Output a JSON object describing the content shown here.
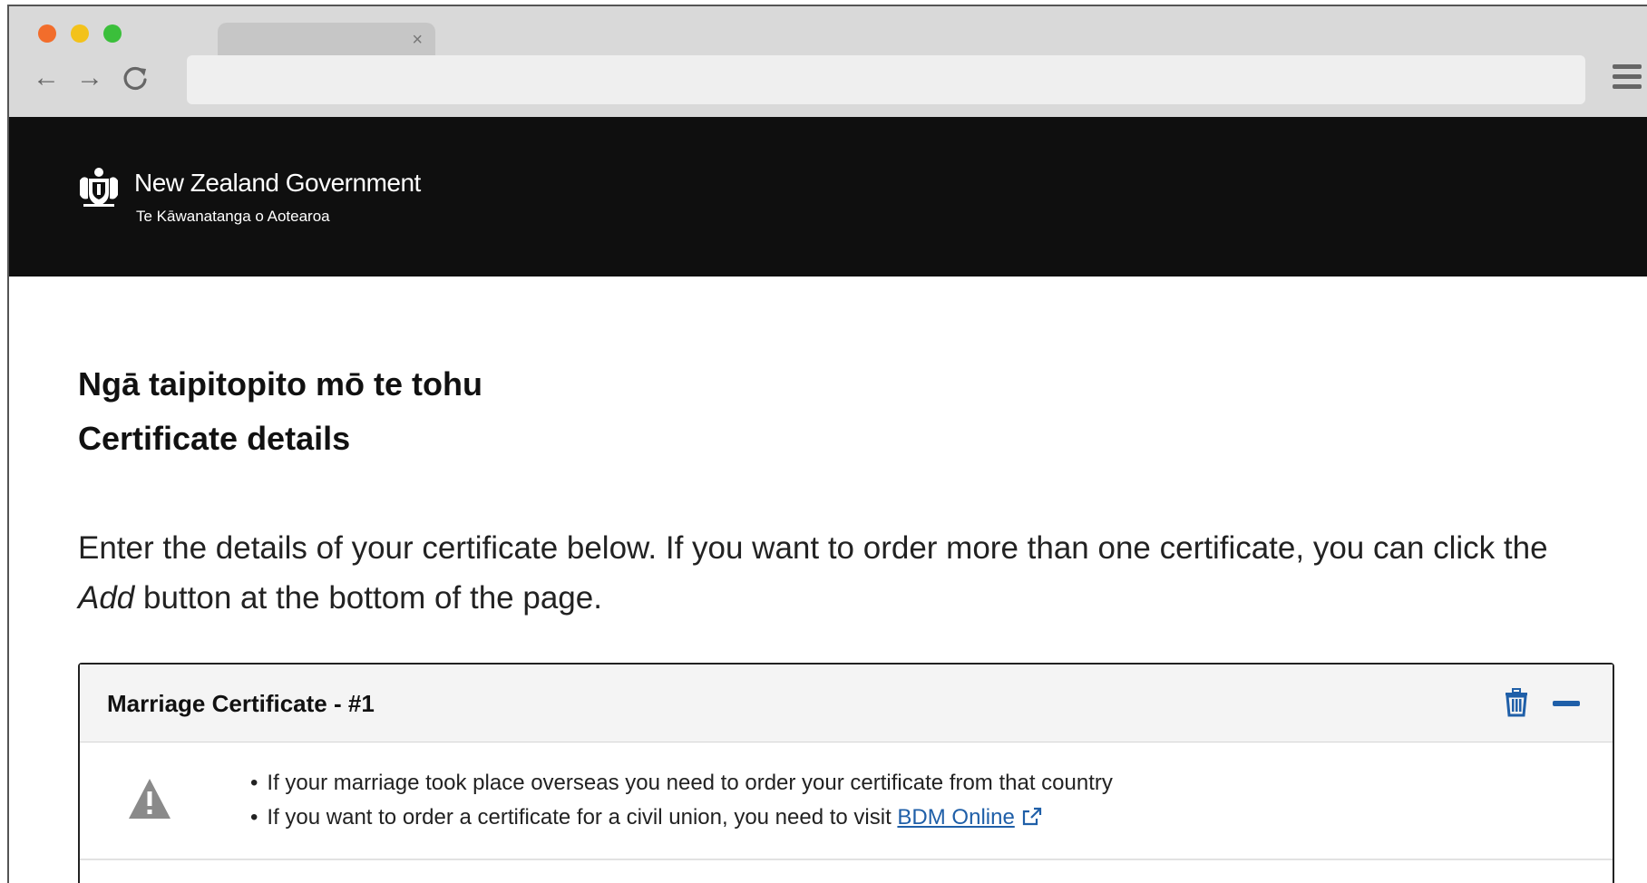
{
  "browser": {
    "tab_close": "×",
    "back_icon": "←",
    "forward_icon": "→",
    "reload_icon": "C"
  },
  "gov_header": {
    "name": "New Zealand Government",
    "subtitle": "Te Kāwanatanga o Aotearoa"
  },
  "page": {
    "heading_maori": "Ngā taipitopito mō te tohu",
    "heading_english": "Certificate details",
    "intro_before": "Enter the details of your certificate below. If you want to order more than one certificate, you can click the ",
    "intro_em": "Add",
    "intro_after": " button at the bottom of the page."
  },
  "panel": {
    "title": "Marriage Certificate - #1",
    "notices": {
      "item1": "If your marriage took place overseas you need to order your certificate from that country",
      "item2_text": "If you want to order a certificate for a civil union, you need to visit ",
      "item2_link": "BDM Online"
    }
  },
  "colors": {
    "header_bg": "#0f0f0f",
    "link": "#1f5fa8",
    "accent_icon": "#1f5fa8"
  }
}
